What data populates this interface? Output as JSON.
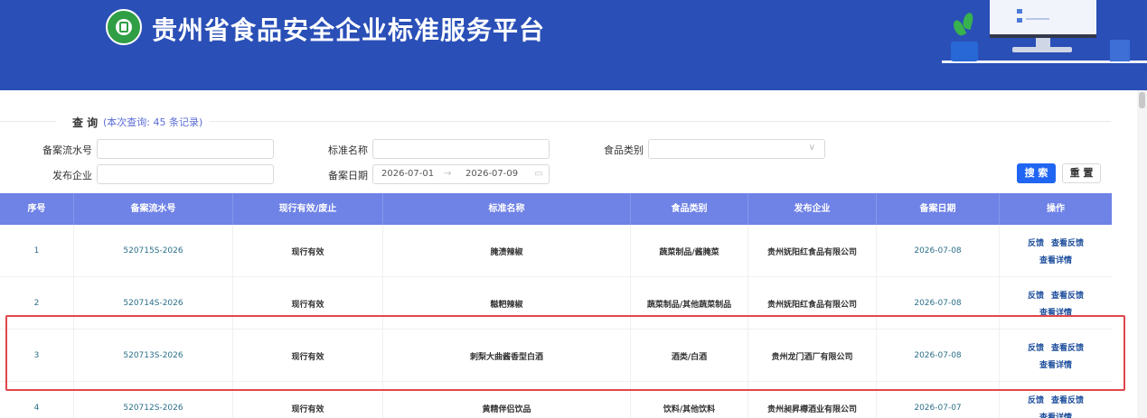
{
  "header": {
    "title": "贵州省食品安全企业标准服务平台",
    "brand_color": "#2a4fb7"
  },
  "query": {
    "title": "查 询",
    "count_text": "(本次查询: 45 条记录)",
    "fields": {
      "serial_label": "备案流水号",
      "serial_value": "",
      "standard_name_label": "标准名称",
      "standard_name_value": "",
      "food_category_label": "食品类别",
      "food_category_value": "",
      "publisher_label": "发布企业",
      "publisher_value": "",
      "date_label": "备案日期",
      "date_start": "2026-07-01",
      "date_sep": "→",
      "date_end": "2026-07-09"
    },
    "search_button": "搜 索",
    "reset_button": "重 置"
  },
  "table": {
    "columns": [
      "序号",
      "备案流水号",
      "现行有效/废止",
      "标准名称",
      "食品类别",
      "发布企业",
      "备案日期",
      "操作"
    ],
    "rows": [
      {
        "index": "1",
        "serial": "520715S-2026",
        "status": "现行有效",
        "name": "腌渍辣椒",
        "category": "蔬菜制品/酱腌菜",
        "company": "贵州妩阳红食品有限公司",
        "date": "2026-07-08"
      },
      {
        "index": "2",
        "serial": "520714S-2026",
        "status": "现行有效",
        "name": "糍粑辣椒",
        "category": "蔬菜制品/其他蔬菜制品",
        "company": "贵州妩阳红食品有限公司",
        "date": "2026-07-08"
      },
      {
        "index": "3",
        "serial": "520713S-2026",
        "status": "现行有效",
        "name": "刺梨大曲酱香型白酒",
        "category": "酒类/白酒",
        "company": "贵州龙门酒厂有限公司",
        "date": "2026-07-08"
      },
      {
        "index": "4",
        "serial": "520712S-2026",
        "status": "现行有效",
        "name": "黄精伴侣饮品",
        "category": "饮料/其他饮料",
        "company": "贵州昶昇樽酒业有限公司",
        "date": "2026-07-07"
      }
    ],
    "actions": {
      "feedback": "反馈",
      "view_feedback": "查看反馈",
      "view_details": "查看详情"
    }
  },
  "colors": {
    "table_header": "#6f82e6",
    "primary_button": "#2166f3",
    "highlight_border": "#e0464b"
  }
}
